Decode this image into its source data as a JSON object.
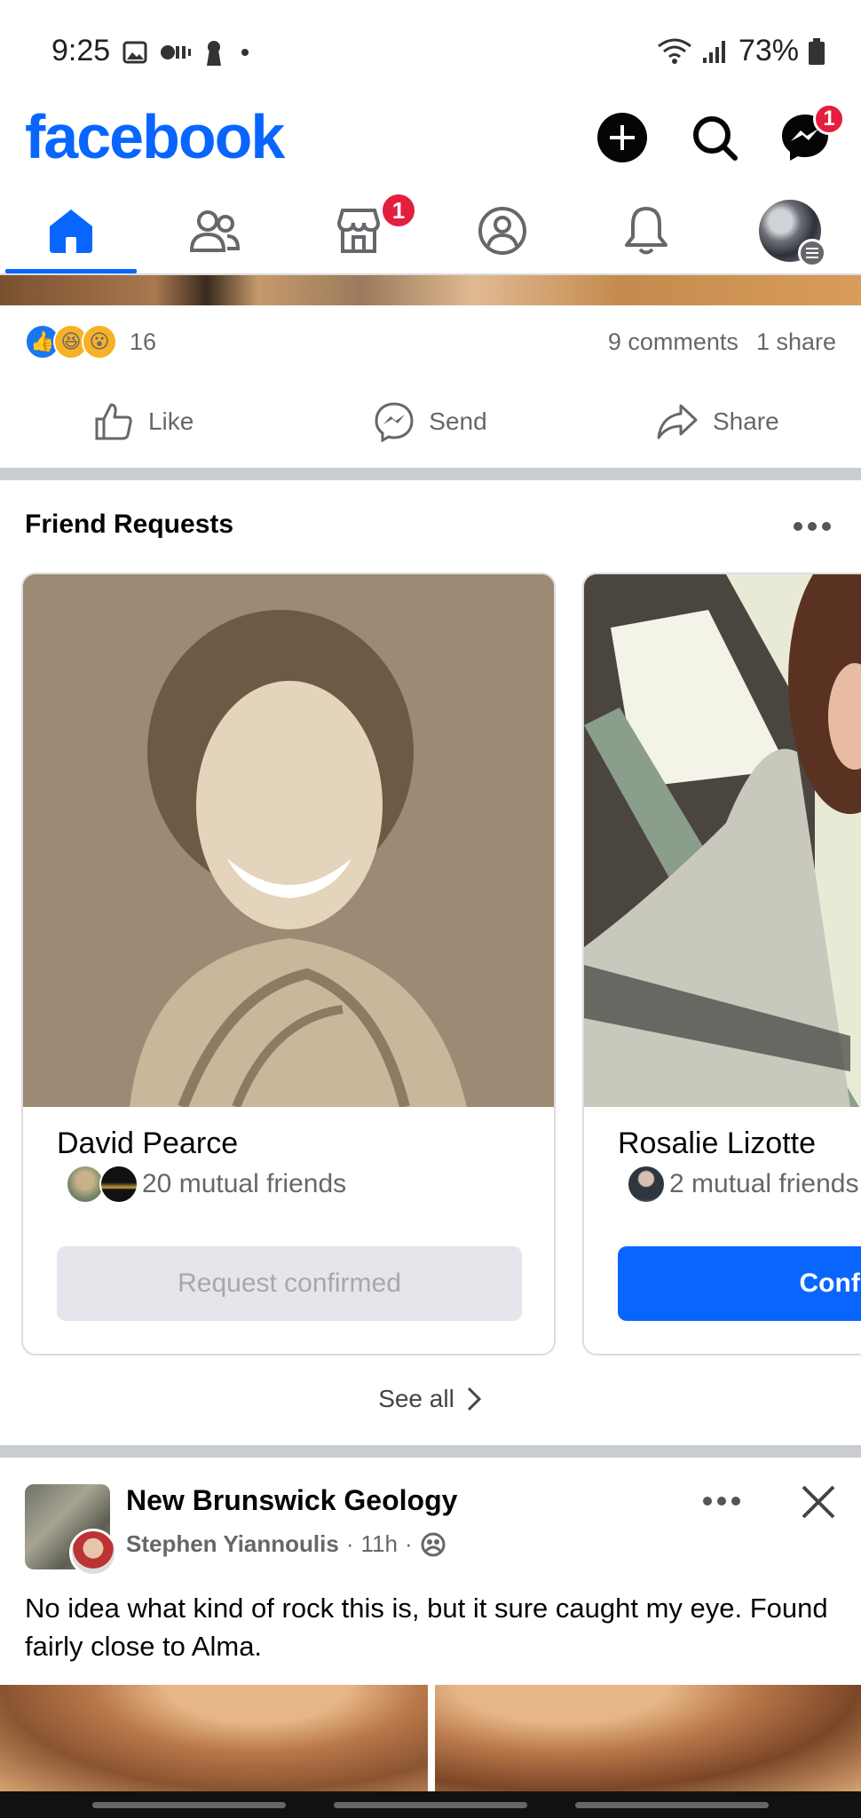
{
  "status_bar": {
    "time": "9:25",
    "battery": "73%"
  },
  "header": {
    "logo": "facebook",
    "messenger_badge": "1"
  },
  "nav": {
    "marketplace_badge": "1"
  },
  "previous_post": {
    "reaction_count": "16",
    "comments": "9 comments",
    "shares": "1 share",
    "actions": {
      "like": "Like",
      "send": "Send",
      "share": "Share"
    }
  },
  "friend_requests": {
    "title": "Friend Requests",
    "requests": [
      {
        "name": "David Pearce",
        "mutual": "20 mutual friends",
        "button": "Request confirmed"
      },
      {
        "name": "Rosalie Lizotte",
        "mutual": "2 mutual friends",
        "button": "Confirm"
      }
    ],
    "see_all": "See all"
  },
  "post": {
    "group": "New Brunswick Geology",
    "author": "Stephen Yiannoulis",
    "time": "11h",
    "text": "No idea what kind of rock this is,  but it sure caught my eye. Found fairly close to Alma."
  },
  "colors": {
    "brand": "#0866ff",
    "badge": "#e41e3f",
    "muted": "#65676b"
  }
}
